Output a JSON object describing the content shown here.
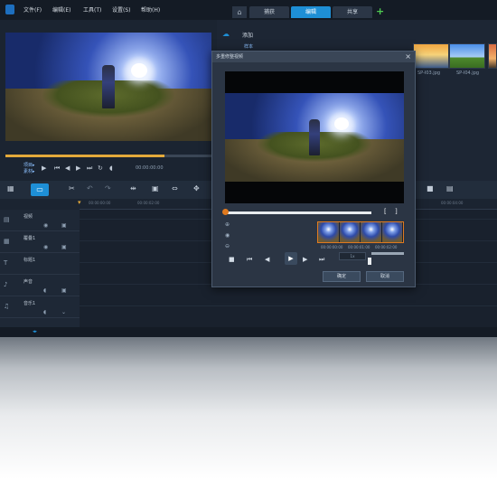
{
  "menubar": {
    "items": [
      "文件(F)",
      "编辑(E)",
      "工具(T)",
      "设置(S)",
      "帮助(H)"
    ],
    "home_icon": "home-icon",
    "steps": [
      {
        "label": "捕获",
        "active": false
      },
      {
        "label": "编辑",
        "active": true
      },
      {
        "label": "共享",
        "active": false
      }
    ],
    "add_icon": "plus-icon"
  },
  "player": {
    "mode_project": "项目▸",
    "mode_clip": "素材▸",
    "timecode": "00:00:00:00"
  },
  "library": {
    "add_label": "添加",
    "folder_label": "样本",
    "thumbnails": [
      {
        "caption": "SP-I03.jpg"
      },
      {
        "caption": "SP-I04.jpg"
      }
    ]
  },
  "timeline": {
    "ruler_marks": [
      "00:00:00:00",
      "00:00:02:00",
      "00:00:04:00"
    ],
    "tracks": [
      {
        "label": "视频",
        "icon": "film-icon"
      },
      {
        "label": "覆叠1",
        "icon": "overlay-icon"
      },
      {
        "label": "标题1",
        "icon": "title-icon"
      },
      {
        "label": "声音",
        "icon": "voice-icon"
      },
      {
        "label": "音乐1",
        "icon": "music-icon"
      }
    ]
  },
  "dialog": {
    "title": "多重修整视频",
    "close": "×",
    "frame_captions": [
      "00:00:00:00",
      "00:00:01:00",
      "00:00:02:00"
    ],
    "zoom_label": "1x",
    "ok_label": "确定",
    "cancel_label": "取消",
    "progress": 0.02
  },
  "colors": {
    "accent": "#1e8fd6",
    "trim_orange": "#e07a1f",
    "scrub_gold": "#e3a93a",
    "add_green": "#4ecb52"
  }
}
